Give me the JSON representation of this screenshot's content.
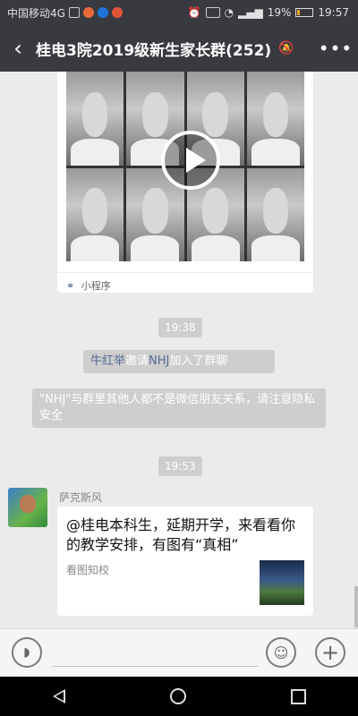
{
  "status_bar": {
    "carrier": "中国移动4G",
    "battery_percent": "19%",
    "battery_level": 0.19,
    "time": "19:57",
    "app_icon_colors": [
      "#e86a3c",
      "#1e73d8",
      "#e0553a"
    ],
    "icons": [
      "sim-icon",
      "app-icon",
      "app-icon",
      "app-icon",
      "alarm-icon",
      "hd-icon",
      "wifi-icon",
      "signal-icon",
      "battery-icon"
    ]
  },
  "header": {
    "title": "桂电3院2019级新生家长群(252)",
    "back_icon": "back-arrow-icon",
    "mute_icon": "bell-muted-icon",
    "more_icon": "more-icon"
  },
  "chat": {
    "video_card": {
      "source_label": "小程序",
      "source_icon": "mini-program-icon",
      "play_icon": "play-icon"
    },
    "timestamp_1": "19:38",
    "invite_notice": {
      "inviter": "牛红举",
      "verb": "邀请",
      "invitee": "NHJ",
      "suffix": "加入了群聊"
    },
    "privacy_notice": "\"NHJ\"与群里其他人都不是微信朋友关系，请注意隐私安全",
    "timestamp_2": "19:53",
    "message": {
      "sender": "萨克斯风",
      "title": "@桂电本科生，延期开学，来看看你的教学安排，有图有“真相”",
      "desc": "看图知校"
    }
  },
  "input_bar": {
    "voice_icon": "voice-icon",
    "emoji_icon": "emoji-icon",
    "plus_icon": "plus-icon"
  },
  "system_nav": {
    "back": "nav-back-icon",
    "home": "nav-home-icon",
    "recent": "nav-recent-icon"
  }
}
